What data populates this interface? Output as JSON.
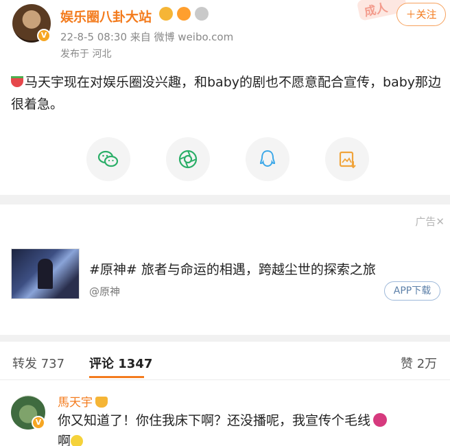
{
  "post": {
    "username": "娱乐圈八卦大站",
    "meta": "22-8-5 08:30  来自 微博 weibo.com",
    "location": "发布于 河北",
    "adult_tag": "成人",
    "follow_label": "＋关注",
    "content": "马天宇现在对娱乐圈没兴趣，和baby的剧也不愿意配合宣传，baby那边很着急。",
    "avatar_badge": "V"
  },
  "share": {
    "items": [
      {
        "name": "wechat",
        "icon": "wechat-icon",
        "color": "#2aae67"
      },
      {
        "name": "moments",
        "icon": "moments-icon",
        "color": "#2aae67"
      },
      {
        "name": "qq",
        "icon": "qq-icon",
        "color": "#3aa7e8"
      },
      {
        "name": "save-image",
        "icon": "save-image-icon",
        "color": "#f0a33a"
      }
    ]
  },
  "ad": {
    "label": "广告✕",
    "title": "#原神# 旅者与命运的相遇，跨越尘世的探索之旅",
    "source": "@原神",
    "button": "APP下载"
  },
  "tabs": {
    "repost": "转发 737",
    "comment": "评论 1347",
    "like": "赞 2万"
  },
  "comment": {
    "username": "馬天宇",
    "text": "你又知道了！你住我床下啊？还没播呢，我宣传个毛线",
    "text_line2": "啊",
    "avatar_badge": "V"
  },
  "colors": {
    "accent": "#f37b1d",
    "divider": "#f1f1f1"
  }
}
